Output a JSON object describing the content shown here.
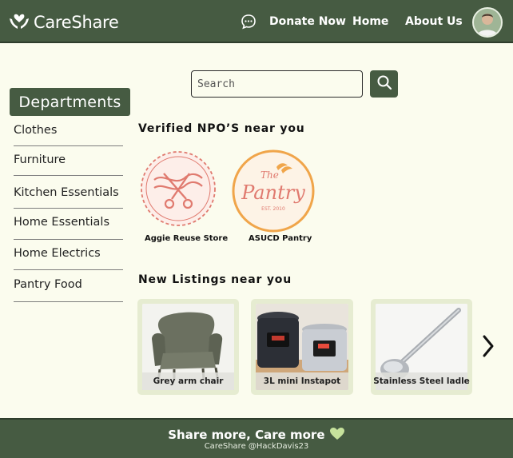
{
  "header": {
    "brand_name": "CareShare",
    "nav": {
      "donate": "Donate Now",
      "home": "Home",
      "about": "About Us"
    }
  },
  "search": {
    "placeholder": "Search",
    "value": ""
  },
  "sidebar": {
    "title": "Departments",
    "items": [
      {
        "label": "Clothes"
      },
      {
        "label": "Furniture"
      },
      {
        "label": "Kitchen Essentials"
      },
      {
        "label": "Home Essentials"
      },
      {
        "label": "Home Electrics"
      },
      {
        "label": "Pantry Food"
      }
    ]
  },
  "npo_section": {
    "title": "Verified NPO’S near you",
    "items": [
      {
        "name": "Aggie Reuse Store",
        "logo_color": "#e07a6f"
      },
      {
        "name": "ASUCD Pantry",
        "logo_color": "#f0a54a",
        "logo_text": "The Pantry",
        "logo_subtext": "EST. 2010"
      }
    ]
  },
  "listings_section": {
    "title": "New Listings near you",
    "items": [
      {
        "label": "Grey arm chair"
      },
      {
        "label": "3L  mini Instapot"
      },
      {
        "label": "Stainless Steel ladle"
      }
    ]
  },
  "footer": {
    "tagline": "Share more, Care more",
    "credit": "CareShare @HackDavis23"
  },
  "colors": {
    "brand_green": "#465b42",
    "background": "#fbfcee",
    "card_bg": "#e6ecd1",
    "heart": "#c6e29c"
  },
  "icons": [
    "hands-heart-logo-icon",
    "chat-icon",
    "search-icon",
    "chevron-right-icon",
    "heart-icon"
  ]
}
